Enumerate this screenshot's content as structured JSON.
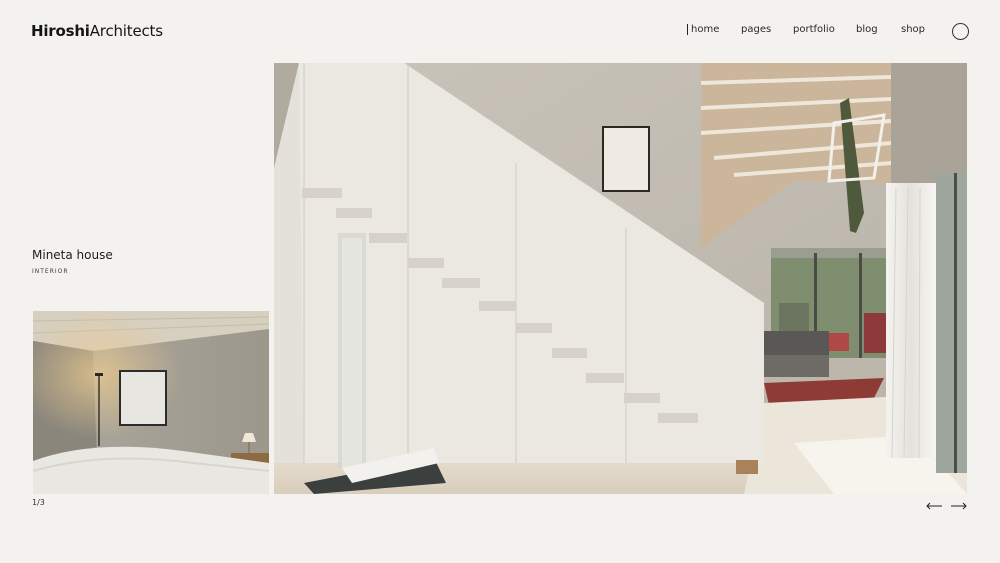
{
  "header": {
    "logo_bold": "Hiroshi",
    "logo_regular": "Architects",
    "nav": [
      {
        "label": "home",
        "active": true
      },
      {
        "label": "pages",
        "active": false
      },
      {
        "label": "portfolio",
        "active": false
      },
      {
        "label": "blog",
        "active": false
      },
      {
        "label": "shop",
        "active": false
      }
    ],
    "menu_icon": "circle-icon"
  },
  "project": {
    "title": "Mineta house",
    "category": "INTERIOR"
  },
  "slider": {
    "counter": "1/3",
    "prev_icon": "arrow-left-icon",
    "next_icon": "arrow-right-icon"
  },
  "colors": {
    "background": "#f3f2ee",
    "text": "#1d1d1b"
  }
}
